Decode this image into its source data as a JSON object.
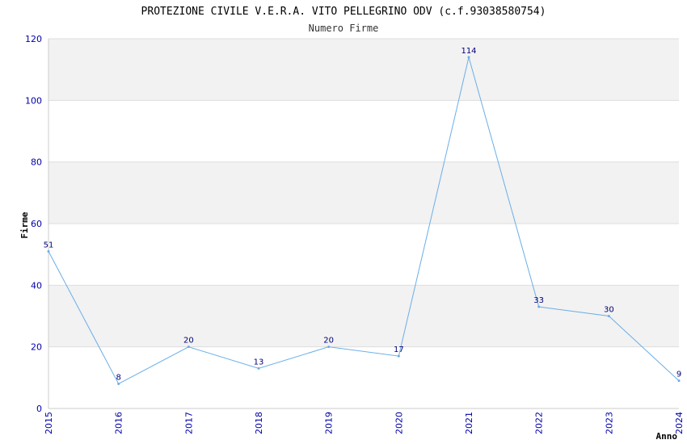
{
  "chart_data": {
    "type": "line",
    "title": "PROTEZIONE CIVILE V.E.R.A. VITO PELLEGRINO ODV (c.f.93038580754)",
    "subtitle": "Numero Firme",
    "xlabel": "Anno",
    "ylabel": "Firme",
    "categories": [
      "2015",
      "2016",
      "2017",
      "2018",
      "2019",
      "2020",
      "2021",
      "2022",
      "2023",
      "2024"
    ],
    "series": [
      {
        "values": [
          51,
          8,
          20,
          13,
          20,
          17,
          114,
          33,
          30,
          9
        ]
      }
    ],
    "data_labels": [
      "51",
      "8",
      "20",
      "13",
      "20",
      "17",
      "114",
      "33",
      "30",
      "9"
    ],
    "ylim": [
      0,
      120
    ],
    "yticks": [
      "0",
      "20",
      "40",
      "60",
      "80",
      "100",
      "120"
    ],
    "grid": true,
    "colors": {
      "line": "#6aaee8",
      "band": "#f2f2f2",
      "tick_text": "#0000aa",
      "data_label": "#000077"
    }
  }
}
